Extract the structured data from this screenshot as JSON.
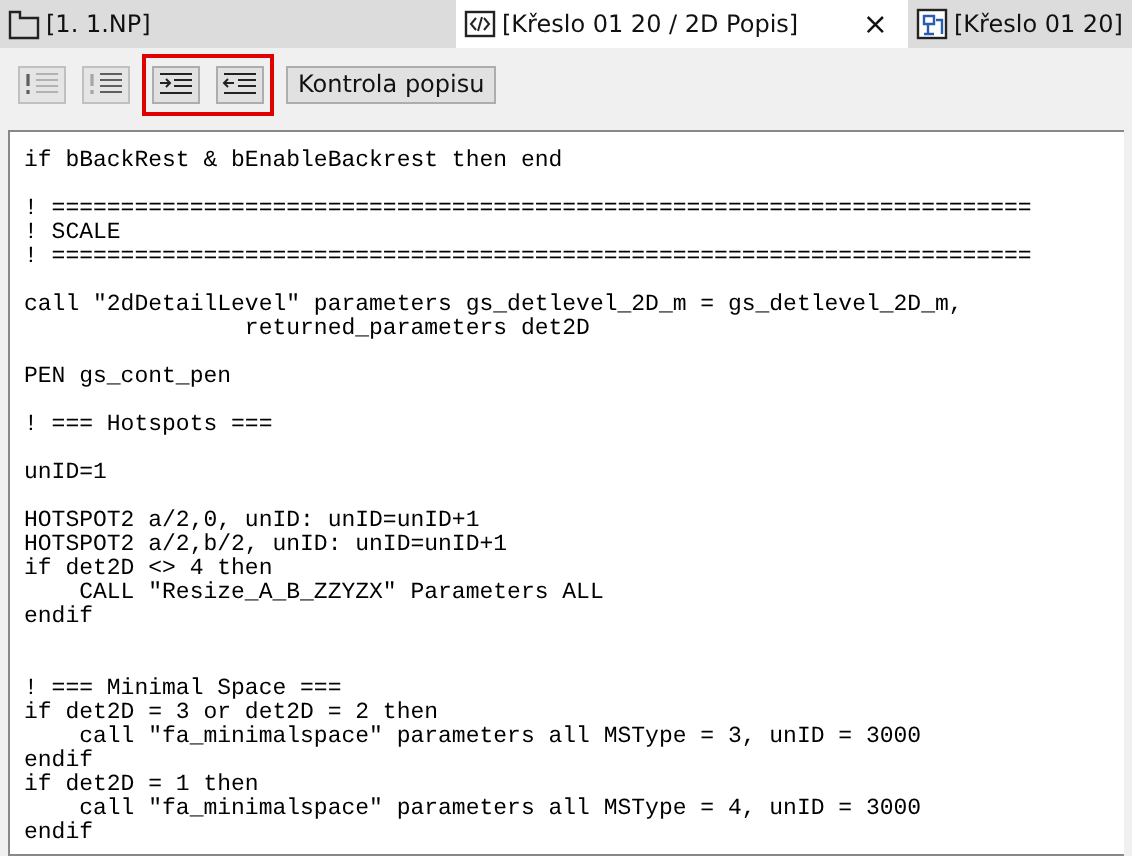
{
  "tabs": [
    {
      "label": "[1. 1.NP]",
      "selected": false
    },
    {
      "label": "[Křeslo 01 20 / 2D Popis]",
      "selected": true,
      "close": "×"
    },
    {
      "label": "[Křeslo 01 20]",
      "selected": false
    }
  ],
  "toolbar": {
    "groups": [
      {
        "highlighted": false,
        "buttons": [
          {
            "kind": "icon",
            "disabled": true
          },
          {
            "kind": "icon",
            "disabled": true
          }
        ]
      },
      {
        "highlighted": true,
        "buttons": [
          {
            "kind": "icon",
            "disabled": false
          },
          {
            "kind": "icon",
            "disabled": false
          }
        ]
      },
      {
        "highlighted": false,
        "buttons": [
          {
            "kind": "text",
            "label": "Kontrola popisu",
            "disabled": false
          }
        ]
      }
    ]
  },
  "editor": {
    "text": "if bBackRest & bEnableBackrest then end\n\n! =======================================================================\n! SCALE\n! =======================================================================\n\ncall \"2dDetailLevel\" parameters gs_detlevel_2D_m = gs_detlevel_2D_m,\n                returned_parameters det2D\n\nPEN gs_cont_pen\n\n! === Hotspots ===\n\nunID=1\n\nHOTSPOT2 a/2,0, unID: unID=unID+1\nHOTSPOT2 a/2,b/2, unID: unID=unID+1\nif det2D <> 4 then\n    CALL \"Resize_A_B_ZZYZX\" Parameters ALL\nendif\n\n\n! === Minimal Space ===\nif det2D = 3 or det2D = 2 then\n    call \"fa_minimalspace\" parameters all MSType = 3, unID = 3000\nendif\nif det2D = 1 then\n    call \"fa_minimalspace\" parameters all MSType = 4, unID = 3000\nendif"
  }
}
